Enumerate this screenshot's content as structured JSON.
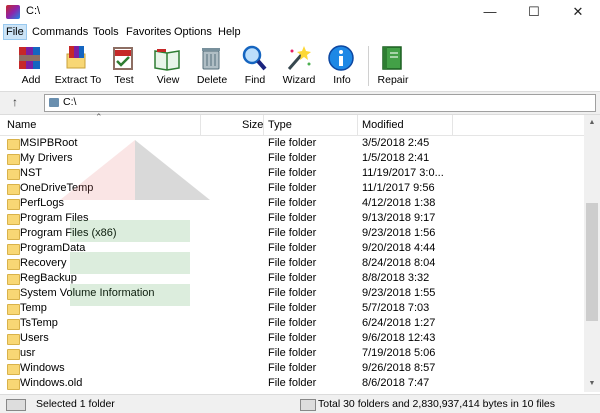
{
  "window": {
    "title": "C:\\",
    "minimize": "—",
    "maximize": "☐",
    "close": "✕"
  },
  "menu": [
    "File",
    "Commands",
    "Tools",
    "Favorites",
    "Options",
    "Help"
  ],
  "toolbar": [
    {
      "label": "Add",
      "icon": "add-archive-icon"
    },
    {
      "label": "Extract To",
      "icon": "extract-icon"
    },
    {
      "label": "Test",
      "icon": "test-icon"
    },
    {
      "label": "View",
      "icon": "view-book-icon"
    },
    {
      "label": "Delete",
      "icon": "trash-icon"
    },
    {
      "label": "Find",
      "icon": "magnifier-icon"
    },
    {
      "label": "Wizard",
      "icon": "wand-icon"
    },
    {
      "label": "Info",
      "icon": "info-icon"
    },
    {
      "label": "Repair",
      "icon": "repair-book-icon"
    }
  ],
  "address": {
    "up": "↑",
    "path": "C:\\"
  },
  "columns": {
    "name": "Name",
    "size": "Size",
    "type": "Type",
    "modified": "Modified"
  },
  "files": [
    {
      "name": "MSIPBRoot",
      "type": "File folder",
      "modified": "3/5/2018 2:45"
    },
    {
      "name": "My Drivers",
      "type": "File folder",
      "modified": "1/5/2018 2:41"
    },
    {
      "name": "NST",
      "type": "File folder",
      "modified": "11/19/2017 3:0..."
    },
    {
      "name": "OneDriveTemp",
      "type": "File folder",
      "modified": "11/1/2017 9:56"
    },
    {
      "name": "PerfLogs",
      "type": "File folder",
      "modified": "4/12/2018 1:38"
    },
    {
      "name": "Program Files",
      "type": "File folder",
      "modified": "9/13/2018 9:17"
    },
    {
      "name": "Program Files (x86)",
      "type": "File folder",
      "modified": "9/23/2018 1:56"
    },
    {
      "name": "ProgramData",
      "type": "File folder",
      "modified": "9/20/2018 4:44"
    },
    {
      "name": "Recovery",
      "type": "File folder",
      "modified": "8/24/2018 8:04"
    },
    {
      "name": "RegBackup",
      "type": "File folder",
      "modified": "8/8/2018 3:32"
    },
    {
      "name": "System Volume Information",
      "type": "File folder",
      "modified": "9/23/2018 1:55"
    },
    {
      "name": "Temp",
      "type": "File folder",
      "modified": "5/7/2018 7:03"
    },
    {
      "name": "TsTemp",
      "type": "File folder",
      "modified": "6/24/2018 1:27"
    },
    {
      "name": "Users",
      "type": "File folder",
      "modified": "9/6/2018 12:43"
    },
    {
      "name": "usr",
      "type": "File folder",
      "modified": "7/19/2018 5:06"
    },
    {
      "name": "Windows",
      "type": "File folder",
      "modified": "9/26/2018 8:57"
    },
    {
      "name": "Windows.old",
      "type": "File folder",
      "modified": "8/6/2018 7:47"
    }
  ],
  "status": {
    "left": "Selected 1 folder",
    "right": "Total 30 folders and 2,830,937,414 bytes in 10 files"
  },
  "colors": {
    "folder": "#f8d775",
    "menu_highlight": "#cce4f7"
  }
}
